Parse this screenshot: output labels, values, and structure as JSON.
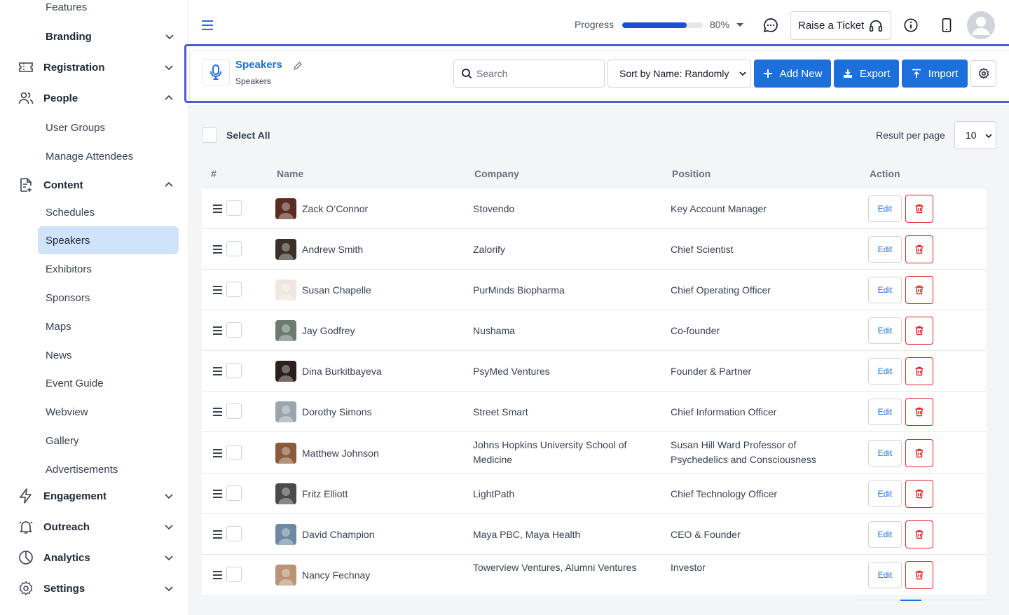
{
  "sidebar": {
    "features": "Features",
    "branding": "Branding",
    "registration": "Registration",
    "people": "People",
    "people_items": [
      "User Groups",
      "Manage Attendees"
    ],
    "content": "Content",
    "content_items": [
      "Schedules",
      "Speakers",
      "Exhibitors",
      "Sponsors",
      "Maps",
      "News",
      "Event Guide",
      "Webview",
      "Gallery",
      "Advertisements"
    ],
    "engagement": "Engagement",
    "outreach": "Outreach",
    "analytics": "Analytics",
    "settings": "Settings"
  },
  "topbar": {
    "progress_label": "Progress",
    "progress_value": 80,
    "progress_text": "80%",
    "raise_ticket": "Raise a Ticket"
  },
  "header": {
    "title": "Speakers",
    "subtitle": "Speakers",
    "search_placeholder": "Search",
    "sort_value": "Sort by Name: Randomly",
    "add_new": "Add New",
    "export": "Export",
    "import": "Import"
  },
  "toolbar": {
    "select_all": "Select All",
    "results_per_page_label": "Result per page",
    "results_per_page": "10"
  },
  "table": {
    "columns": [
      "#",
      "Name",
      "Company",
      "Position",
      "Action"
    ],
    "edit_label": "Edit",
    "rows": [
      {
        "name": "Zack O’Connor",
        "company": "Stovendo",
        "position": "Key Account Manager"
      },
      {
        "name": "Andrew Smith",
        "company": "Zalorify",
        "position": "Chief Scientist"
      },
      {
        "name": "Susan Chapelle",
        "company": "PurMinds Biopharma",
        "position": "Chief Operating Officer"
      },
      {
        "name": "Jay Godfrey",
        "company": "Nushama",
        "position": "Co-founder"
      },
      {
        "name": "Dina Burkitbayeva",
        "company": "PsyMed Ventures",
        "position": "Founder & Partner"
      },
      {
        "name": "Dorothy Simons",
        "company": "Street Smart",
        "position": "Chief Information Officer"
      },
      {
        "name": "Matthew Johnson",
        "company": "Johns Hopkins University School of Medicine",
        "position": "Susan Hill Ward Professor of Psychedelics and Consciousness"
      },
      {
        "name": "Fritz Elliott",
        "company": "LightPath",
        "position": "Chief Technology Officer"
      },
      {
        "name": "David Champion",
        "company": "Maya PBC, Maya Health",
        "position": "CEO & Founder"
      },
      {
        "name": "Nancy Fechnay",
        "company": "Towerview Ventures, Alumni Ventures",
        "position": "Investor"
      }
    ]
  },
  "colors": {
    "accent": "#1d6fdc",
    "active_nav": "#cfe4fb",
    "danger": "#dc2626",
    "header_outline": "#4f5bd5"
  }
}
